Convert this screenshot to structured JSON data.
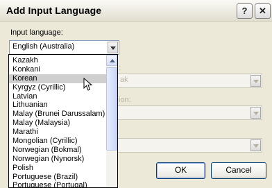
{
  "window": {
    "title": "Add Input Language"
  },
  "titlebar_buttons": {
    "help": "?",
    "close": "✕"
  },
  "input_language": {
    "label": "Input language:",
    "value": "English (Australia)",
    "options": [
      "Kazakh",
      "Konkani",
      "Korean",
      "Kyrgyz (Cyrillic)",
      "Latvian",
      "Lithuanian",
      "Malay (Brunei Darussalam)",
      "Malay (Malaysia)",
      "Marathi",
      "Mongolian (Cyrillic)",
      "Norwegian (Bokmal)",
      "Norwegian (Nynorsk)",
      "Polish",
      "Portuguese (Brazil)",
      "Portuguese (Portugal)"
    ],
    "selected_option": "Korean"
  },
  "disabled_fields": {
    "layout_label_fragment": ":",
    "layout_value_fragment": "ak",
    "ime_label_fragment": "ion:"
  },
  "buttons": {
    "ok": "OK",
    "cancel": "Cancel"
  }
}
